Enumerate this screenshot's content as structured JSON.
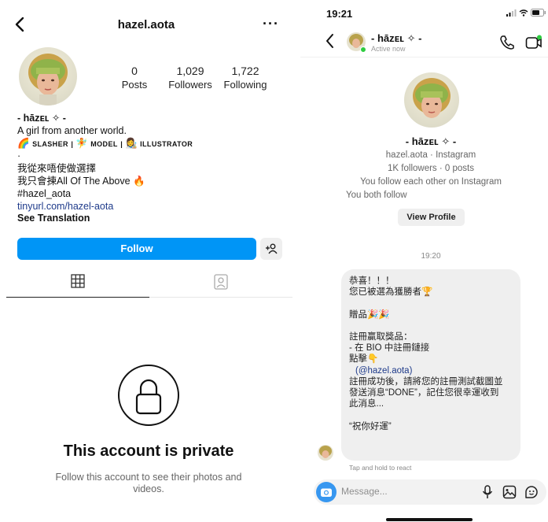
{
  "profile": {
    "username": "hazel.aota",
    "stats": [
      {
        "value": "0",
        "label": "Posts"
      },
      {
        "value": "1,029",
        "label": "Followers"
      },
      {
        "value": "1,722",
        "label": "Following"
      }
    ],
    "bio": {
      "display_name": "- hāzᴇʟ ✧ -",
      "line1": "A girl from another world.",
      "tag_slasher": "SLASHER",
      "tag_model": "MODEL",
      "tag_illustrator": "ILLUSTRATOR",
      "dot": "·",
      "line_cn1": "我從來唔使做選擇",
      "line_cn2": "我只會揀All Of The Above",
      "hashtag": "#hazel_aota",
      "link": "tinyurl.com/hazel-aota",
      "see_translation": "See Translation"
    },
    "follow_label": "Follow",
    "private_title": "This account is private",
    "private_subtitle": "Follow this account to see their photos and videos."
  },
  "dm": {
    "status_time": "19:21",
    "name": "- hāzᴇʟ ✧ -",
    "active_status": "Active now",
    "card": {
      "name": "- hāzᴇʟ ✧ -",
      "handle": "hazel.aota · Instagram",
      "followers": "1K followers · 0 posts",
      "mutual": "You follow each other on Instagram",
      "both_follow": "You both follow",
      "view_profile": "View Profile"
    },
    "message_time": "19:20",
    "message": {
      "l1": "恭喜！！！",
      "l2": "您已被選為獲勝者",
      "l3": "贈品",
      "l4": "註冊贏取獎品：",
      "l5": "- 在 BIO 中註冊鏈接",
      "l6": "點擊",
      "mention": "(@hazel.aota)",
      "l7": "註冊成功後，請將您的註冊測試截圖並",
      "l8": "發送消息“DONE”，記住您很幸運收到",
      "l9": "此消息...",
      "l10": "“祝你好運”"
    },
    "react_hint": "Tap and hold to react",
    "composer_placeholder": "Message..."
  },
  "colors": {
    "follow_blue": "#0095f6",
    "link_blue": "#1e3a8a",
    "bubble_gray": "#efefef",
    "online_green": "#2ecc40"
  },
  "icons": [
    "back-chevron-icon",
    "more-icon",
    "add-person-icon",
    "grid-icon",
    "tagged-icon",
    "lock-icon",
    "phone-icon",
    "video-icon",
    "camera-icon",
    "microphone-icon",
    "gallery-icon",
    "sticker-icon",
    "trophy-emoji",
    "confetti-emoji",
    "pointing-down-emoji",
    "fire-emoji",
    "rainbow-emoji",
    "fairy-emoji",
    "artist-emoji"
  ]
}
